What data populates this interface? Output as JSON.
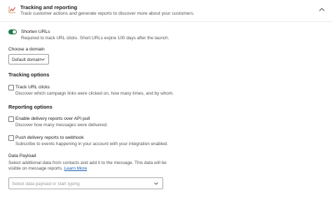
{
  "header": {
    "title": "Tracking and reporting",
    "subtitle": "Track customer actions and generate reports to discover more about your customers.",
    "icon": "chart-icon",
    "collapse_icon": "chevron-up-icon"
  },
  "shorten": {
    "label": "Shorten URLs",
    "description": "Required to track URL clicks. Short URLs expire 100 days after the launch.",
    "enabled": true
  },
  "domain": {
    "label": "Choose a domain",
    "value": "Default domain"
  },
  "tracking": {
    "title": "Tracking options",
    "track_clicks_label": "Track URL clicks",
    "track_clicks_desc": "Discover which campaign links were clicked on, how many times, and by whom.",
    "checked": false
  },
  "reporting": {
    "title": "Reporting options",
    "delivery_label": "Enable delivery reports over API pull",
    "delivery_desc": "Discover how many messages were delivered.",
    "webhook_label": "Push delivery reports to webhook",
    "webhook_desc": "Subscribe to events happening in your account with your integration enabled."
  },
  "payload": {
    "title": "Data Payload",
    "desc_line1": "Select additional data from contacts and add it to the message. This data will be",
    "desc_line2": "visible on message reports.",
    "learn_more": "Learn More",
    "placeholder": "Select data payload or start typing"
  },
  "colors": {
    "accent": "#1e7a4c",
    "link": "#1a5fb4",
    "icon": "#d9534f"
  }
}
